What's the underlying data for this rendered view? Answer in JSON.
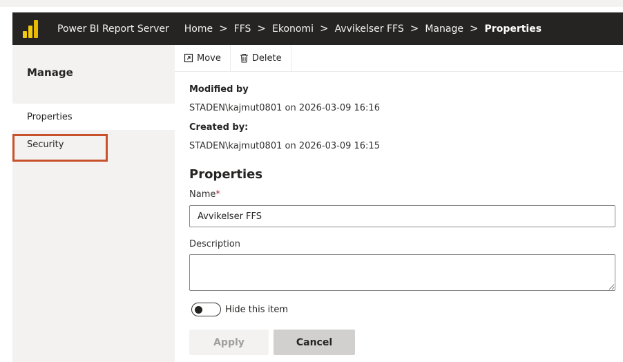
{
  "header": {
    "app_title": "Power BI Report Server",
    "breadcrumbs": [
      "Home",
      "FFS",
      "Ekonomi",
      "Avvikelser FFS",
      "Manage"
    ],
    "current": "Properties",
    "separator": ">"
  },
  "sidebar": {
    "title": "Manage",
    "items": [
      {
        "label": "Properties",
        "selected": true
      },
      {
        "label": "Security",
        "selected": false
      }
    ],
    "highlight_color": "#c8502a"
  },
  "toolbar": {
    "move_label": "Move",
    "delete_label": "Delete"
  },
  "meta": {
    "modified_label": "Modified by",
    "modified_value": "STADEN\\kajmut0801 on 2026-03-09 16:16",
    "created_label": "Created by:",
    "created_value": "STADEN\\kajmut0801 on 2026-03-09 16:15"
  },
  "properties": {
    "title": "Properties",
    "name_label": "Name",
    "required_mark": "*",
    "name_value": "Avvikelser FFS",
    "description_label": "Description",
    "description_value": "",
    "hide_label": "Hide this item",
    "hide_checked": false
  },
  "actions": {
    "apply_label": "Apply",
    "cancel_label": "Cancel"
  },
  "colors": {
    "topbar": "#252423",
    "sidebar": "#f3f2f1",
    "brand_yellow": "#f2c811"
  }
}
